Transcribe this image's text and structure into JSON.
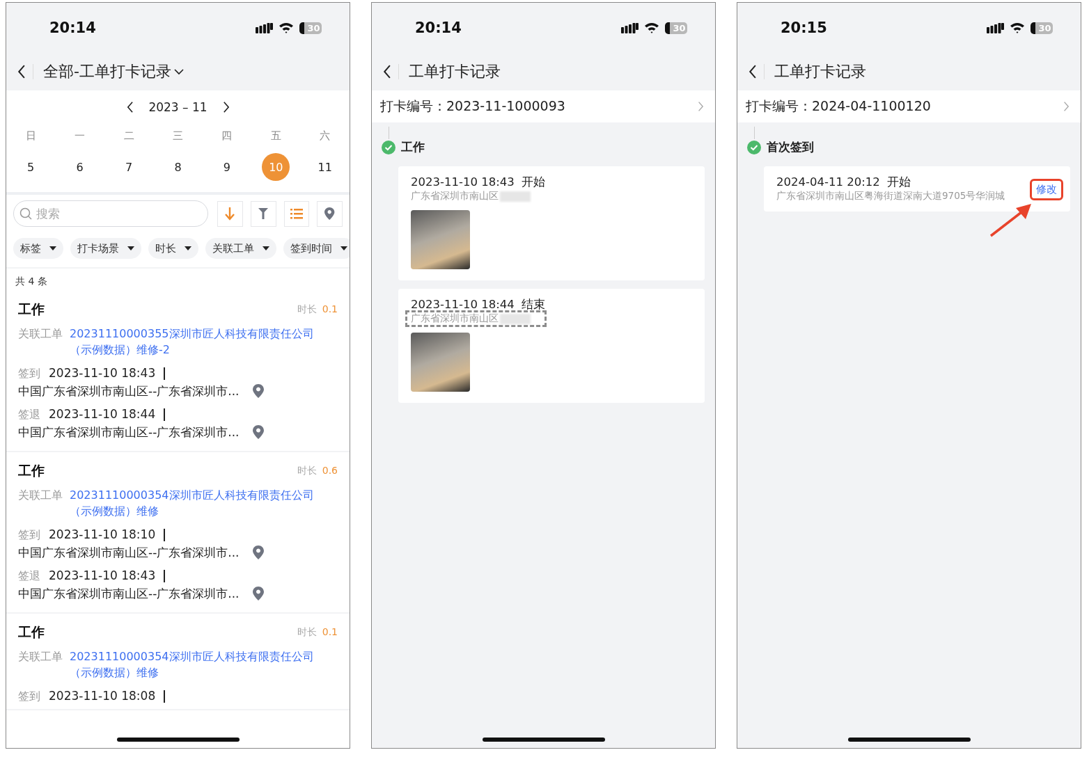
{
  "screens": [
    {
      "kind": "list",
      "status": {
        "time": "20:14",
        "battery": "30"
      },
      "header": {
        "title": "全部-工单打卡记录",
        "dropdown": true
      },
      "calendar": {
        "month": "2023 – 11",
        "weekdays": [
          "日",
          "一",
          "二",
          "三",
          "四",
          "五",
          "六"
        ],
        "days": [
          {
            "label": "5",
            "selected": false
          },
          {
            "label": "6",
            "selected": false
          },
          {
            "label": "7",
            "selected": false
          },
          {
            "label": "8",
            "selected": false
          },
          {
            "label": "9",
            "selected": false
          },
          {
            "label": "10",
            "selected": true
          },
          {
            "label": "11",
            "selected": false
          }
        ]
      },
      "search": {
        "placeholder": "搜索"
      },
      "tools": [
        {
          "kind": "sort",
          "active": true
        },
        {
          "kind": "filter",
          "active": false
        },
        {
          "kind": "list",
          "active": true
        },
        {
          "kind": "location",
          "active": false
        }
      ],
      "filters": [
        {
          "label": "标签"
        },
        {
          "label": "打卡场景"
        },
        {
          "label": "时长"
        },
        {
          "label": "关联工单"
        },
        {
          "label": "签到时间"
        }
      ],
      "total": "共 4 条",
      "records": [
        {
          "title": "工作",
          "duration_label": "时长",
          "duration": "0.1",
          "ticket_label": "关联工单",
          "ticket": "20231110000355深圳市匠人科技有限责任公司（示例数据）维修-2",
          "entries": [
            {
              "label": "签到",
              "time": "2023-11-10 18:43",
              "address": "中国广东省深圳市南山区--广东省深圳市..."
            },
            {
              "label": "签退",
              "time": "2023-11-10 18:44",
              "address": "中国广东省深圳市南山区--广东省深圳市..."
            }
          ]
        },
        {
          "title": "工作",
          "duration_label": "时长",
          "duration": "0.6",
          "ticket_label": "关联工单",
          "ticket": "20231110000354深圳市匠人科技有限责任公司（示例数据）维修",
          "entries": [
            {
              "label": "签到",
              "time": "2023-11-10 18:10",
              "address": "中国广东省深圳市南山区--广东省深圳市..."
            },
            {
              "label": "签退",
              "time": "2023-11-10 18:43",
              "address": "中国广东省深圳市南山区--广东省深圳市..."
            }
          ]
        },
        {
          "title": "工作",
          "duration_label": "时长",
          "duration": "0.1",
          "ticket_label": "关联工单",
          "ticket": "20231110000354深圳市匠人科技有限责任公司（示例数据）维修",
          "entries": [
            {
              "label": "签到",
              "time": "2023-11-10 18:08"
            }
          ]
        }
      ]
    },
    {
      "kind": "detail",
      "status": {
        "time": "20:14",
        "battery": "30"
      },
      "header": {
        "title": "工单打卡记录"
      },
      "code_label": "打卡编号：",
      "code": "2023-11-1000093",
      "step": {
        "title": "工作",
        "done": true
      },
      "punches": [
        {
          "time": "2023-11-10 18:43",
          "action": "开始",
          "address": "广东省深圳市南山区",
          "redacted": true,
          "address_highlighted": false,
          "photo": true
        },
        {
          "time": "2023-11-10 18:44",
          "action": "结束",
          "address": "广东省深圳市南山区",
          "redacted": true,
          "address_highlighted": true,
          "photo": true
        }
      ]
    },
    {
      "kind": "detail",
      "status": {
        "time": "20:15",
        "battery": "30"
      },
      "header": {
        "title": "工单打卡记录"
      },
      "code_label": "打卡编号：",
      "code": "2024-04-1100120",
      "step": {
        "title": "首次签到",
        "done": true
      },
      "punches": [
        {
          "time": "2024-04-11 20:12",
          "action": "开始",
          "address": "广东省深圳市南山区粤海街道深南大道9705号华润城",
          "redacted": false,
          "address_highlighted": false,
          "edit": "修改",
          "edit_highlighted": true
        }
      ]
    }
  ]
}
